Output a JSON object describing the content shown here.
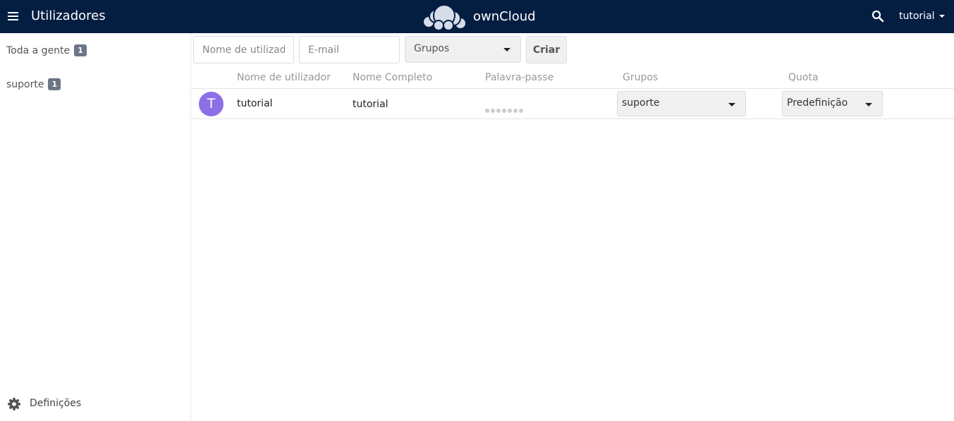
{
  "header": {
    "app_title": "Utilizadores",
    "brand_name": "ownCloud",
    "user_name": "tutorial",
    "bg_color": "#041e42",
    "icons": {
      "menu": "hamburger-menu-icon",
      "search": "search-icon",
      "logo": "owncloud-cloud-icon",
      "user_caret": "caret-down-icon"
    }
  },
  "sidebar": {
    "groups": [
      {
        "label": "Toda a gente",
        "count": "1"
      },
      {
        "label": "suporte",
        "count": "1"
      }
    ],
    "settings_label": "Definições",
    "settings_icon": "gear-icon"
  },
  "new_user_form": {
    "username_placeholder": "Nome de utilizador",
    "email_placeholder": "E-mail",
    "groups_label": "Grupos",
    "create_label": "Criar"
  },
  "table": {
    "headers": {
      "username": "Nome de utilizador",
      "fullname": "Nome Completo",
      "password": "Palavra-passe",
      "groups": "Grupos",
      "quota": "Quota"
    },
    "rows": [
      {
        "avatar_letter": "T",
        "avatar_color": "#8c6ee6",
        "username": "tutorial",
        "fullname": "tutorial",
        "password_masked": "●●●●●●●",
        "groups": "suporte",
        "quota": "Predefinição"
      }
    ]
  }
}
